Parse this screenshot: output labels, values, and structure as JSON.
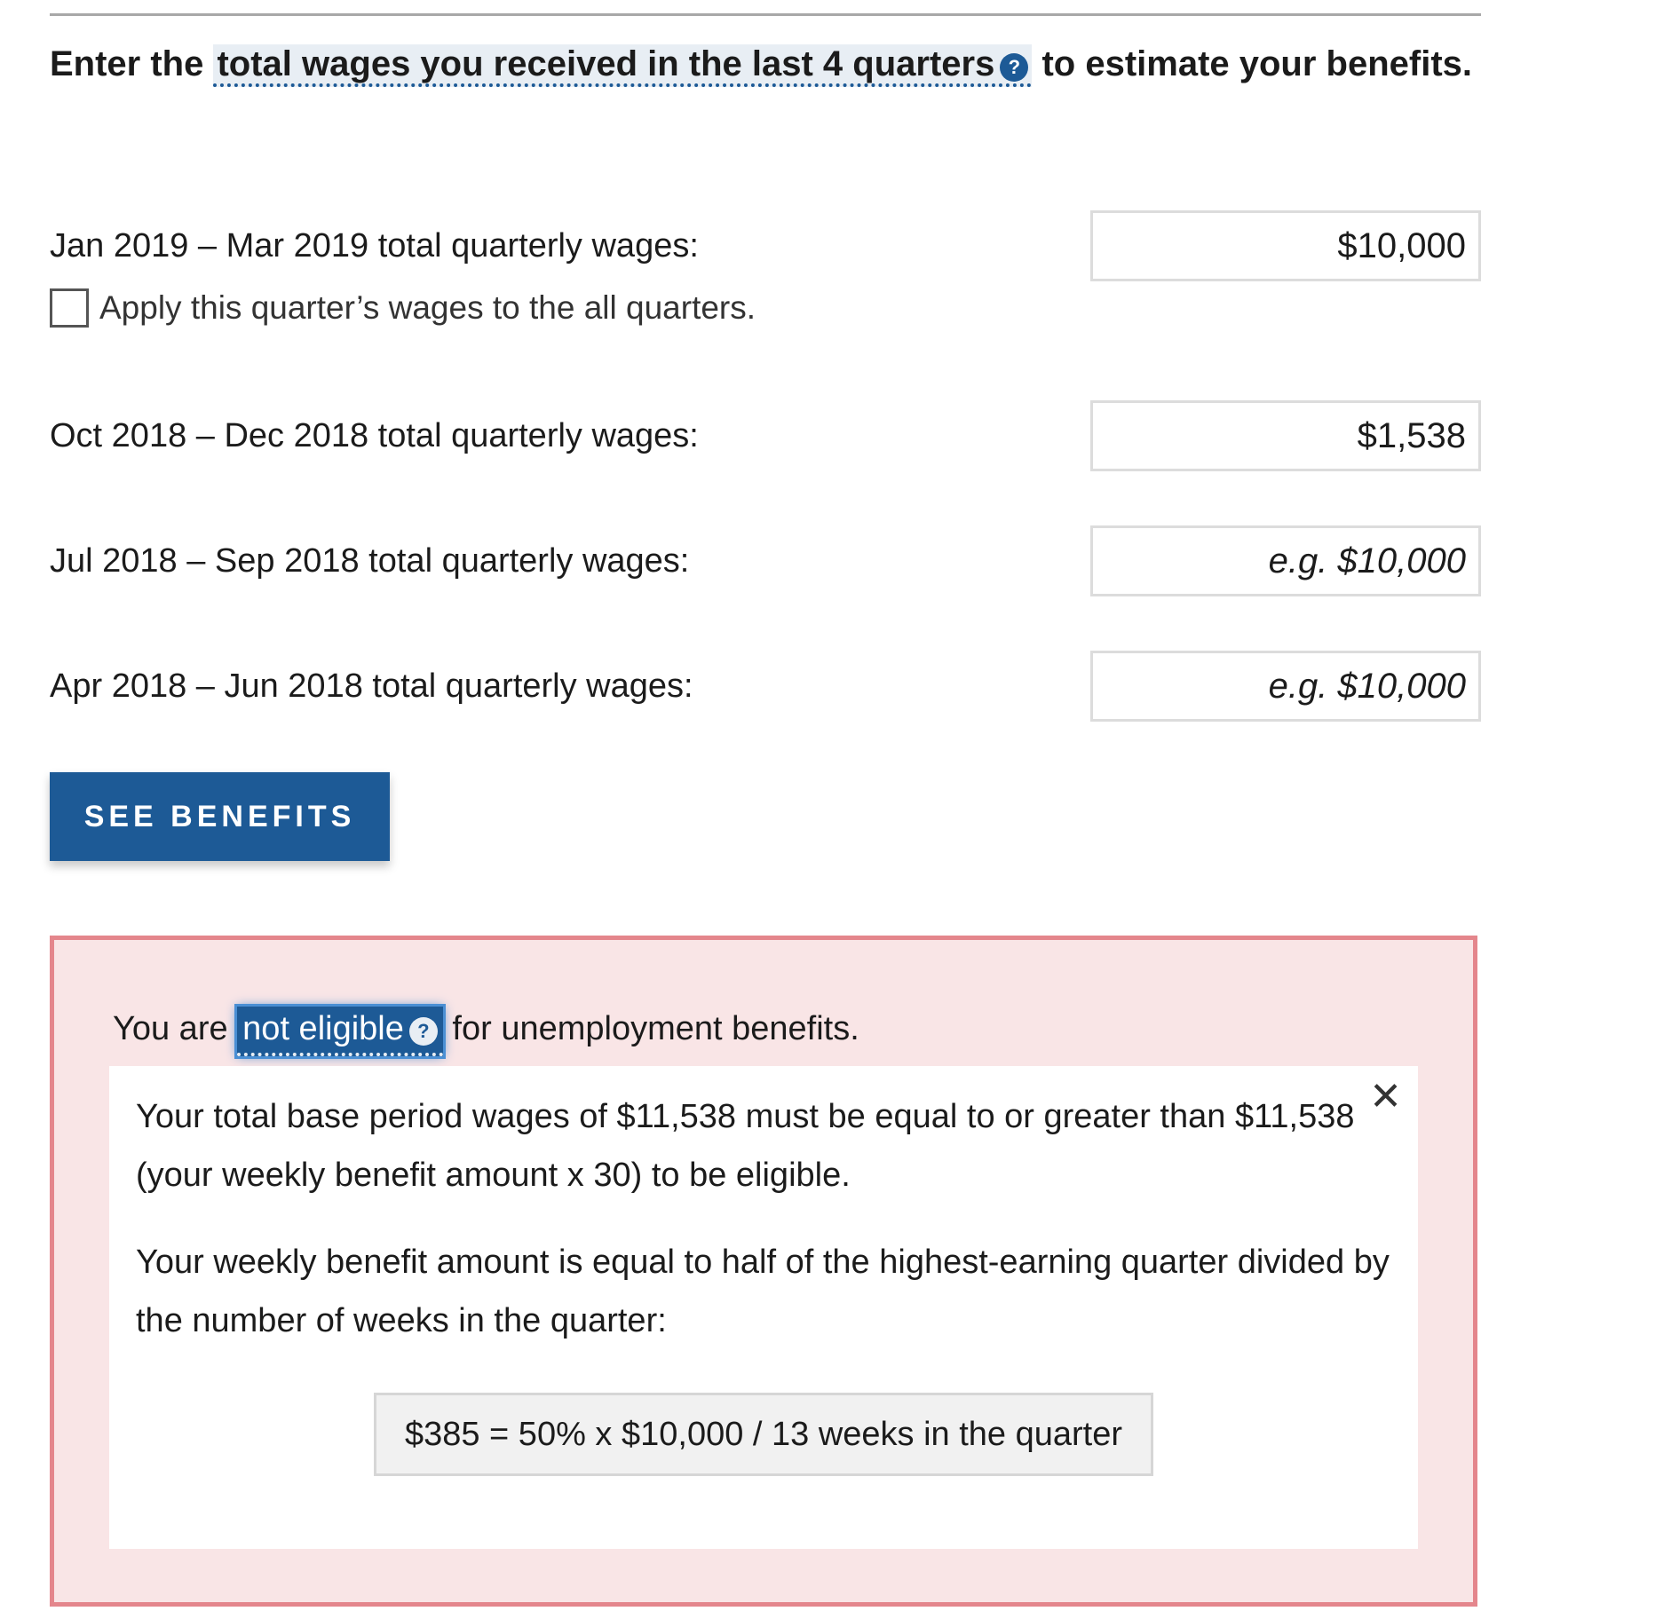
{
  "intro": {
    "prefix": "Enter the ",
    "term": "total wages you received in the last 4 quarters",
    "help_glyph": "?",
    "suffix": " to estimate your benefits."
  },
  "quarters": [
    {
      "label": "Jan 2019 – Mar 2019 total quarterly wages:",
      "value": "$10,000",
      "placeholder": "e.g. $10,000"
    },
    {
      "label": "Oct 2018 – Dec 2018 total quarterly wages:",
      "value": "$1,538",
      "placeholder": "e.g. $10,000"
    },
    {
      "label": "Jul 2018 – Sep 2018 total quarterly wages:",
      "value": "",
      "placeholder": "e.g. $10,000"
    },
    {
      "label": "Apr 2018 – Jun 2018 total quarterly wages:",
      "value": "",
      "placeholder": "e.g. $10,000"
    }
  ],
  "apply_all": {
    "label": "Apply this quarter’s wages to the all quarters.",
    "checked": false
  },
  "see_benefits_label": "SEE BENEFITS",
  "result": {
    "prefix": "You are ",
    "term": "not eligible",
    "help_glyph": "?",
    "suffix": " for unemployment benefits.",
    "close_glyph": "✕",
    "detail_1": "Your total base period wages of $11,538 must be equal to or greater than $11,538 (your weekly benefit amount x 30) to be eligible.",
    "detail_2": "Your weekly benefit amount is equal to half of the highest-earning quarter divided by the number of weeks in the quarter:",
    "formula": "$385 = 50% x $10,000 / 13 weeks in the quarter"
  },
  "colors": {
    "primary": "#1d5a96",
    "error_border": "#e4868c",
    "error_background": "#f9e5e6",
    "highlight_background": "#e8eef4"
  },
  "icons": {
    "help": "question-circle-icon",
    "close": "close-icon"
  }
}
